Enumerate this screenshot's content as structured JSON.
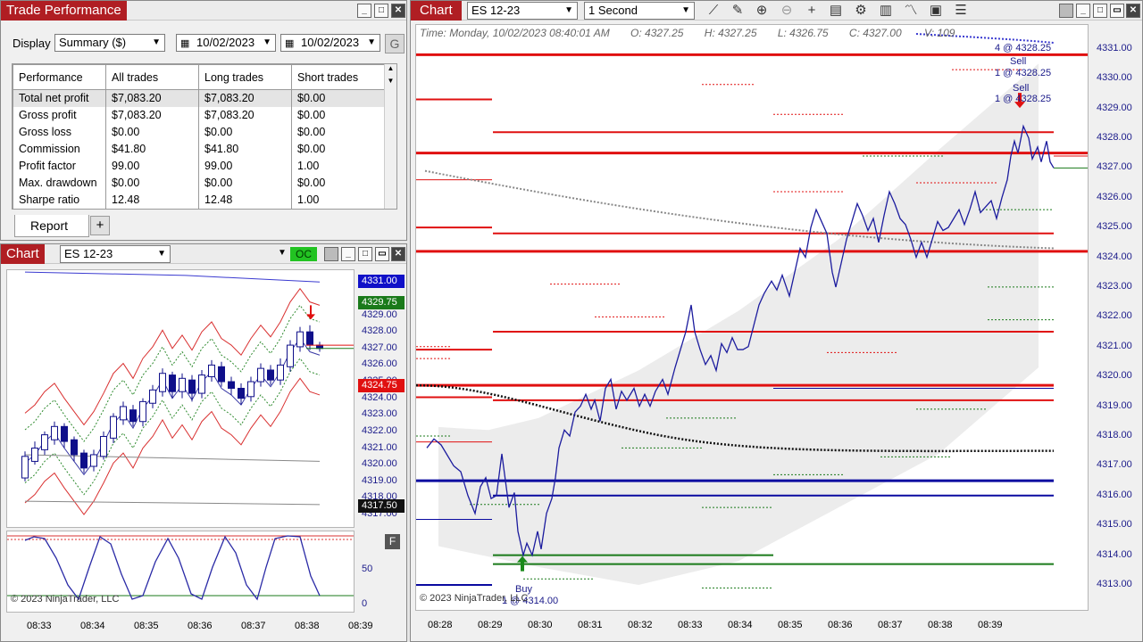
{
  "trade_performance": {
    "title": "Trade Performance",
    "display_label": "Display",
    "display_value": "Summary ($)",
    "date_from": "10/02/2023",
    "date_to": "10/02/2023",
    "go_label": "G",
    "columns": [
      "Performance",
      "All trades",
      "Long trades",
      "Short trades"
    ],
    "rows": [
      [
        "Total net profit",
        "$7,083.20",
        "$7,083.20",
        "$0.00"
      ],
      [
        "Gross profit",
        "$7,083.20",
        "$7,083.20",
        "$0.00"
      ],
      [
        "Gross loss",
        "$0.00",
        "$0.00",
        "$0.00"
      ],
      [
        "Commission",
        "$41.80",
        "$41.80",
        "$0.00"
      ],
      [
        "Profit factor",
        "99.00",
        "99.00",
        "1.00"
      ],
      [
        "Max. drawdown",
        "$0.00",
        "$0.00",
        "$0.00"
      ],
      [
        "Sharpe ratio",
        "12.48",
        "12.48",
        "1.00"
      ]
    ],
    "tab_report": "Report",
    "tab_add": "+"
  },
  "small_chart": {
    "title": "Chart",
    "instrument": "ES 12-23",
    "oc_label": "OC",
    "price_labels": [
      "4331.00",
      "4329.75",
      "4329.00",
      "4328.00",
      "4327.00",
      "4326.00",
      "4325.00",
      "4324.75",
      "4324.00",
      "4323.00",
      "4322.00",
      "4321.00",
      "4320.00",
      "4319.00",
      "4318.00",
      "4317.50",
      "4317.00"
    ],
    "tag_blue": "4331.00",
    "tag_green": "4329.75",
    "tag_red": "4324.75",
    "tag_black": "4317.50",
    "osc_labels": [
      "50",
      "0"
    ],
    "f_label": "F",
    "copyright": "© 2023 NinjaTrader, LLC",
    "times": [
      "08:33",
      "08:34",
      "08:35",
      "08:36",
      "08:37",
      "08:38",
      "08:39"
    ],
    "colors": {
      "up": "#ffffff",
      "down": "#0f0f8a",
      "band_red": "#d93030",
      "band_green": "#2e8a2e",
      "osc": "#2a2aa6"
    }
  },
  "main_chart": {
    "title": "Chart",
    "instrument": "ES 12-23",
    "interval": "1 Second",
    "info": {
      "time": "Time: Monday, 10/02/2023 08:40:01 AM",
      "open": "O: 4327.25",
      "high": "H: 4327.25",
      "low": "L: 4326.75",
      "close": "C: 4327.00",
      "volume": "V: 109"
    },
    "price_labels": [
      "4331.00",
      "4330.00",
      "4329.00",
      "4328.00",
      "4327.00",
      "4326.00",
      "4325.00",
      "4324.00",
      "4323.00",
      "4322.00",
      "4321.00",
      "4320.00",
      "4319.00",
      "4318.00",
      "4317.00",
      "4316.00",
      "4315.00",
      "4314.00",
      "4313.00"
    ],
    "times": [
      "08:28",
      "08:29",
      "08:30",
      "08:31",
      "08:32",
      "08:33",
      "08:34",
      "08:35",
      "08:36",
      "08:37",
      "08:38",
      "08:39"
    ],
    "annotations": {
      "exit_top": "4 @ 4328.25",
      "sell1": "Sell",
      "sell1_px": "1 @ 4328.25",
      "sell2": "Sell",
      "sell2_px": "1 @ 4328.25",
      "buy": "Buy",
      "buy_px": "1 @ 4314.00"
    },
    "copyright": "© 2023 NinjaTrader, LLC",
    "colors": {
      "price": "#1c1c9e",
      "level_red": "#e01010",
      "level_blue": "#0a0aa0",
      "level_green": "#1a7a1a",
      "band": "#ececec"
    }
  }
}
